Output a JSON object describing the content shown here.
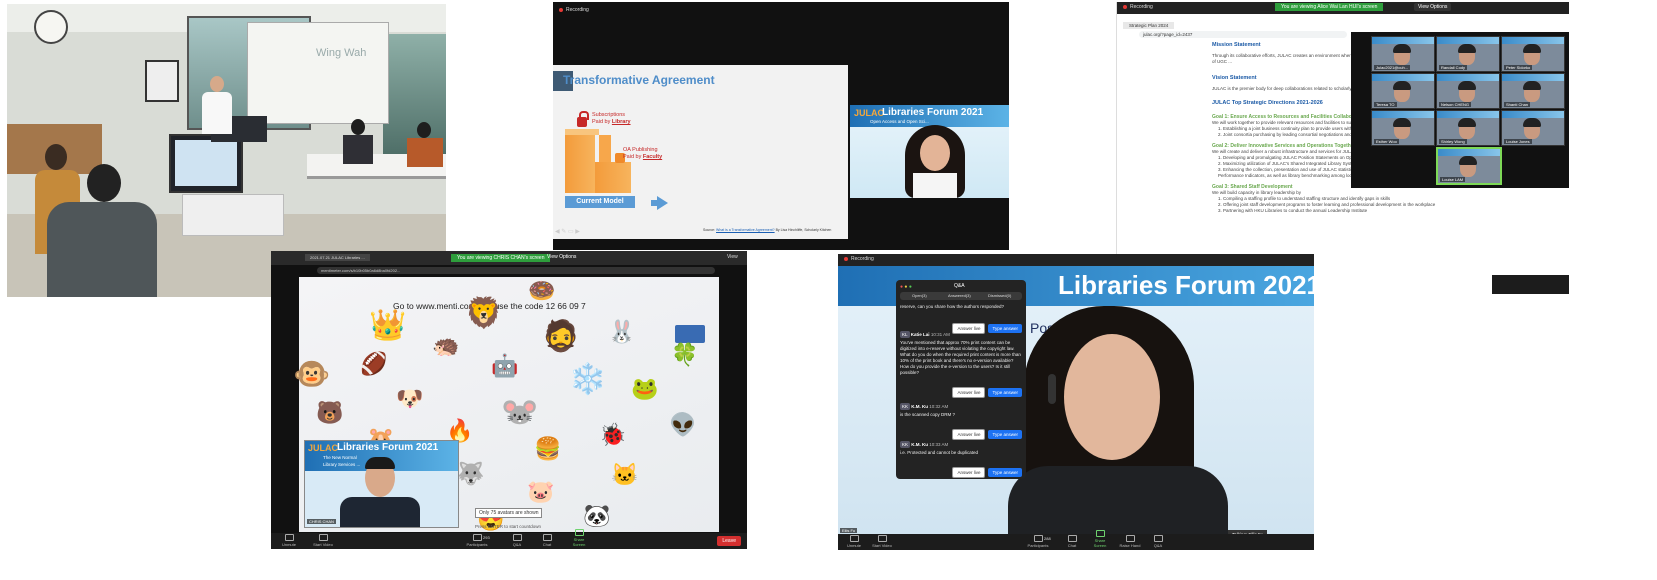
{
  "common": {
    "recording": "Recording",
    "leave": "Leave",
    "forum_left": "JULAC",
    "forum_right": "Libraries Forum 2021"
  },
  "slide": {
    "title": "Transformative Agreement",
    "subs_label": "Subscriptions",
    "subs_paid": "Paid by",
    "subs_who": "Library",
    "oa_label": "OA Publishing",
    "oa_paid": "Paid by",
    "oa_who": "Faculty",
    "current_model": "Current Model",
    "source_prefix": "Source:",
    "source_link": "What is a Transformative Agreement?",
    "source_suffix": "By Lisa Hinchliffe, Scholarly Kitchen"
  },
  "slide_speaker": {
    "caption": "Open Access and Open Sci..."
  },
  "doc_panel": {
    "banner": "You are viewing Alice Wai Lan HUI's screen",
    "view_options": "View Options",
    "tab_title": "Strategic Plan 2024",
    "url": "julac.org/?page_id=2437",
    "heading1": "Mission Statement",
    "para1": "Through its collaborative efforts, JULAC creates an environment where ... delivery of innovative services that enhance academic endeavour of UGC ...",
    "heading2": "Vision Statement",
    "para2": "JULAC is the premier body for deep collaborations related to scholarly info...",
    "heading3": "JULAC Top Strategic Directions 2021-2026",
    "goal1": "Goal 1: Ensure Access to Resources and Facilities Collaboratively",
    "goal1_text": "We will work together to provide relevant resources and facilities to suppo...",
    "goal1_items": [
      "1. Establishing a joint business continuity plan to provide users with co... of crisis",
      "2. Joint consortia purchasing by leading consortial negotiations and fa..."
    ],
    "goal2": "Goal 2: Deliver Innovative Services and Operations Together",
    "goal2_text": "We will create and deliver a robust infrastructure and services for JULAC ...",
    "goal2_items": [
      "1. Developing and promulgating JULAC Position Statements on Open ...",
      "2. Maximizing utilization of JULAC's Shared Integrated Library System to promote collaborative operations and services",
      "3. Enhancing the collection, presentation and use of JULAC statistics to foster data-driven decision making, creation of JULAC Key Performance Indicators, as well as library benchmarking among local and international peers"
    ],
    "goal3": "Goal 3: Shared Staff Development",
    "goal3_text": "We will build capacity in library leadership by",
    "goal3_items": [
      "1. Compiling a staffing profile to understand staffing structure and identify gaps in skills",
      "2. Offering joint staff development programs to foster learning and professional development in the workplace",
      "3. Partnering with HKU Libraries to conduct the annual Leadership Institute"
    ],
    "participants": [
      "Julac2021@cuh...",
      "Randall Cody",
      "Peter Sidorko",
      "Teresa TO",
      "Nelson CHENG",
      "Shanti Chan",
      "Esther Woo",
      "Shirley Wong",
      "Louise Jones",
      "Louise LAM"
    ]
  },
  "menti": {
    "banner": "You are viewing CHRIS CHAN's screen",
    "view_options": "View Options",
    "tab_title": "2021.07.21 JULAC Libraries ...",
    "url": "mentimeter.com/s/b10b05b0a6d8ba0fd202...",
    "view": "View",
    "headline": "Go to www.menti.com and use the code 12 66 09 7",
    "emojis": [
      "🐭",
      "🔥",
      "🤖",
      "🍔",
      "🐶",
      "❄️",
      "🐺",
      "🦔",
      "🐞",
      "🐹",
      "🧔",
      "🐷",
      "🏈",
      "🐸",
      "🍓",
      "🦁",
      "🐱",
      "🐻",
      "🐰",
      "😍",
      "👑",
      "👽",
      "🐷",
      "🍩",
      "🐼",
      "🐵",
      "🍀"
    ],
    "notice": "Only 75 avatars are shown",
    "enter_hint": "Press ENTER to start countdown",
    "speaker_name": "CHRIS CHAN",
    "speaker_banner_sub1": "The New Normal",
    "speaker_banner_sub2": "Library Services ...",
    "toolbar": [
      "Unmute",
      "Start Video",
      "Participants",
      "Q&A",
      "Chat",
      "Share Screen",
      "Leave"
    ],
    "participant_count": "293"
  },
  "qa_panel": {
    "banner_forum": "Libraries Forum 2021",
    "post": "Post C",
    "window_title": "Q&A",
    "tabs": [
      "Open(3)",
      "Answered(3)",
      "Dismissed(0)"
    ],
    "items": [
      {
        "initials": "",
        "name": "",
        "time": "",
        "text": "reserve, can you share how the authors responded?"
      },
      {
        "initials": "KL",
        "name": "Katie Lai",
        "time": "10:31 AM",
        "text": "You've mentioned that approx 70% print content can be digitized into e-reserve without violating the copyright law. What do you do when the required print content is more than 10% of the print book and there's no e-version available? How do you provide the e-version to the users? Is it still possible?"
      },
      {
        "initials": "KK",
        "name": "K.M. Ku",
        "time": "10:32 AM",
        "text": "is the scanned copy DRM ?"
      },
      {
        "initials": "KK",
        "name": "K.M. Ku",
        "time": "10:33 AM",
        "text": "i.e. Protected and cannot be duplicated"
      }
    ],
    "answer_live": "Answer live",
    "type_answer": "Type answer",
    "speaker_tag": "Ellis Fu",
    "talking": "Talking: Ellis Fu",
    "toolbar": [
      "Unmute",
      "Start Video",
      "Participants",
      "Chat",
      "Share Screen",
      "Raise Hand",
      "Q&A"
    ],
    "participant_count": "288"
  },
  "photo": {
    "wall_text": "Wing Wah"
  }
}
